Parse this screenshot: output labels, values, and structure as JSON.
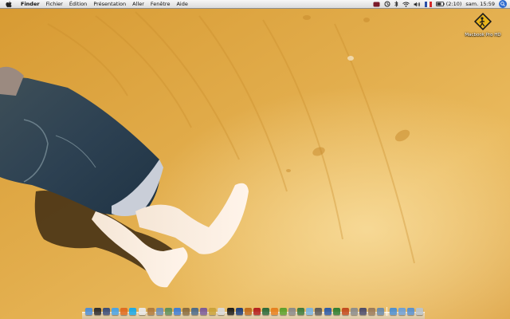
{
  "menubar": {
    "app_name": "Finder",
    "menus": [
      "Fichier",
      "Édition",
      "Présentation",
      "Aller",
      "Fenêtre",
      "Aide"
    ],
    "battery_text": "(2:10)",
    "clock": "sam. 15:59"
  },
  "desktop": {
    "drive_label": "Macbook Pro HD"
  },
  "dock": {
    "icons": [
      {
        "name": "finder-icon",
        "color": "#4f8fd8"
      },
      {
        "name": "dashboard-icon",
        "color": "#2d2d2d"
      },
      {
        "name": "expose-icon",
        "color": "#3a4d7a"
      },
      {
        "name": "safari-icon",
        "color": "#4aa3e6"
      },
      {
        "name": "firefox-icon",
        "color": "#e06b1f"
      },
      {
        "name": "skype-icon",
        "color": "#1aa9e8"
      },
      {
        "name": "ical-icon",
        "color": "#e8e8e8"
      },
      {
        "name": "address-book-icon",
        "color": "#b07a3d"
      },
      {
        "name": "mail-icon",
        "color": "#6e8fb8"
      },
      {
        "name": "preview-icon",
        "color": "#5f8f5a"
      },
      {
        "name": "itunes-icon",
        "color": "#3f7ed6"
      },
      {
        "name": "photo-icon",
        "color": "#8a6c3f"
      },
      {
        "name": "iphoto-icon",
        "color": "#4c6a8a"
      },
      {
        "name": "imovie-icon",
        "color": "#7a5a9a"
      },
      {
        "name": "garageband-icon",
        "color": "#c9a23a"
      },
      {
        "name": "textedit-icon",
        "color": "#d9d9d9"
      },
      {
        "name": "terminal-icon",
        "color": "#1c1c1c"
      },
      {
        "name": "photoshop-icon",
        "color": "#1d3e7a"
      },
      {
        "name": "illustrator-icon",
        "color": "#c06a1a"
      },
      {
        "name": "flash-icon",
        "color": "#b31e1e"
      },
      {
        "name": "dreamweaver-icon",
        "color": "#2a6a3a"
      },
      {
        "name": "vlc-icon",
        "color": "#e7801e"
      },
      {
        "name": "utorrent-icon",
        "color": "#5aa02c"
      },
      {
        "name": "system-preferences-icon",
        "color": "#8a8a8a"
      },
      {
        "name": "activity-monitor-icon",
        "color": "#3d7a3d"
      },
      {
        "name": "chat-icon",
        "color": "#7bb3e0"
      },
      {
        "name": "calculator-icon",
        "color": "#5a5a5a"
      },
      {
        "name": "word-icon",
        "color": "#2b5aa8"
      },
      {
        "name": "excel-icon",
        "color": "#2e7d32"
      },
      {
        "name": "powerpoint-icon",
        "color": "#c2491d"
      },
      {
        "name": "automator-icon",
        "color": "#8c8c8c"
      },
      {
        "name": "app-icon-31",
        "color": "#4b4b6b"
      },
      {
        "name": "app-icon-32",
        "color": "#9a7a5a"
      },
      {
        "name": "app-icon-33",
        "color": "#6a8aaa"
      }
    ],
    "stacks": [
      {
        "name": "applications-stack-icon",
        "color": "#4c8fd1"
      },
      {
        "name": "documents-stack-icon",
        "color": "#6ea0d6"
      },
      {
        "name": "downloads-stack-icon",
        "color": "#5890cf"
      },
      {
        "name": "trash-icon",
        "color": "#b9c4cc"
      }
    ]
  }
}
